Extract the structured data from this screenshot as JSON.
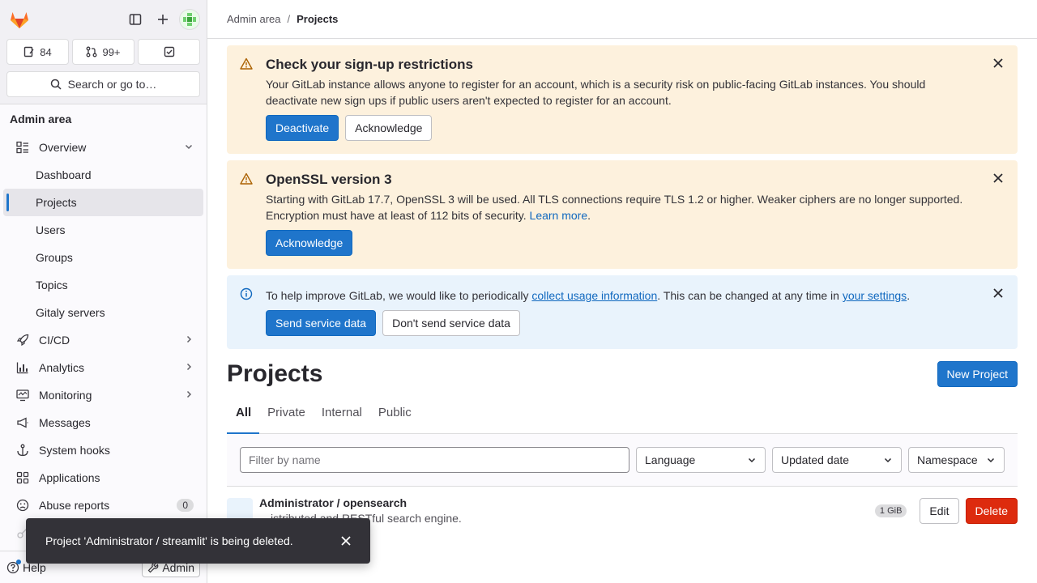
{
  "sidebar": {
    "counters": [
      {
        "icon": "issues-icon",
        "value": "84"
      },
      {
        "icon": "merge-request-icon",
        "value": "99+"
      },
      {
        "icon": "todo-icon",
        "value": ""
      }
    ],
    "search_label": "Search or go to…",
    "section_title": "Admin area",
    "overview_label": "Overview",
    "sub_items": [
      "Dashboard",
      "Projects",
      "Users",
      "Groups",
      "Topics",
      "Gitaly servers"
    ],
    "cicd_label": "CI/CD",
    "analytics_label": "Analytics",
    "monitoring_label": "Monitoring",
    "messages_label": "Messages",
    "system_hooks_label": "System hooks",
    "applications_label": "Applications",
    "abuse_label": "Abuse reports",
    "abuse_count": "0",
    "help_label": "Help",
    "admin_label": "Admin"
  },
  "breadcrumb": {
    "parent": "Admin area",
    "separator": "/",
    "current": "Projects"
  },
  "alerts": {
    "signup": {
      "title": "Check your sign-up restrictions",
      "body": "Your GitLab instance allows anyone to register for an account, which is a security risk on public-facing GitLab instances. You should deactivate new sign ups if public users aren't expected to register for an account.",
      "primary": "Deactivate",
      "secondary": "Acknowledge"
    },
    "openssl": {
      "title": "OpenSSL version 3",
      "body": "Starting with GitLab 17.7, OpenSSL 3 will be used. All TLS connections require TLS 1.2 or higher. Weaker ciphers are no longer supported. Encryption must have at least of 112 bits of security.",
      "link": "Learn more",
      "after_link": ".",
      "primary": "Acknowledge"
    },
    "usage": {
      "text_before": "To help improve GitLab, we would like to periodically ",
      "link1": "collect usage information",
      "text_middle": ". This can be changed at any time in ",
      "link2": "your settings",
      "text_after": ".",
      "primary": "Send service data",
      "secondary": "Don't send service data"
    }
  },
  "page": {
    "title": "Projects",
    "new_project": "New Project",
    "tabs": [
      "All",
      "Private",
      "Internal",
      "Public"
    ],
    "active_tab": "All",
    "filter_placeholder": "Filter by name",
    "language_label": "Language",
    "sort_label": "Updated date",
    "namespace_label": "Namespace"
  },
  "projects": [
    {
      "name": "Administrator / opensearch",
      "description": "…istributed and RESTful search engine.",
      "size": "1 GiB",
      "edit": "Edit",
      "delete": "Delete"
    }
  ],
  "toast": {
    "message": "Project 'Administrator / streamlit' is being deleted."
  },
  "colors": {
    "primary": "#1f75cb",
    "danger": "#dd2b0e",
    "warning_bg": "#fdf1dd",
    "info_bg": "#e9f3fc"
  }
}
